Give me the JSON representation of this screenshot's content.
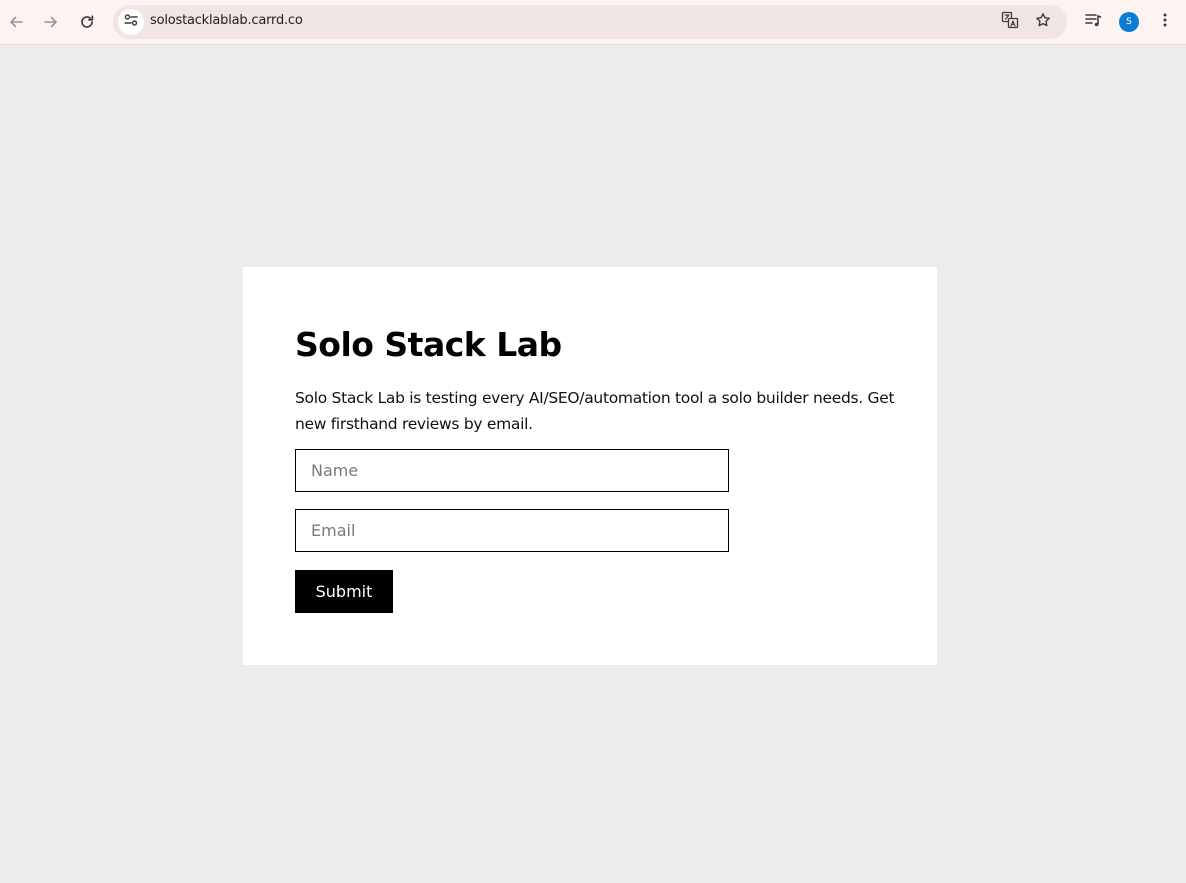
{
  "browser": {
    "url": "solostacklablab.carrd.co",
    "profile_initial": "S",
    "accent_color": "#0b7dd6",
    "icons": {
      "back": "arrow-left-icon",
      "forward": "arrow-right-icon",
      "reload": "reload-icon",
      "site_info": "tune-icon",
      "translate": "translate-icon",
      "bookmark": "star-icon",
      "media": "media-queue-icon",
      "menu": "kebab-menu-icon"
    }
  },
  "page": {
    "title": "Solo Stack Lab",
    "description": "Solo Stack Lab is testing every AI/SEO/automation tool a solo builder needs. Get new firsthand reviews by email.",
    "form": {
      "name_placeholder": "Name",
      "name_value": "",
      "email_placeholder": "Email",
      "email_value": "",
      "submit_label": "Submit"
    },
    "colors": {
      "page_background": "#ececec",
      "card_background": "#ffffff",
      "button_background": "#000000"
    }
  }
}
